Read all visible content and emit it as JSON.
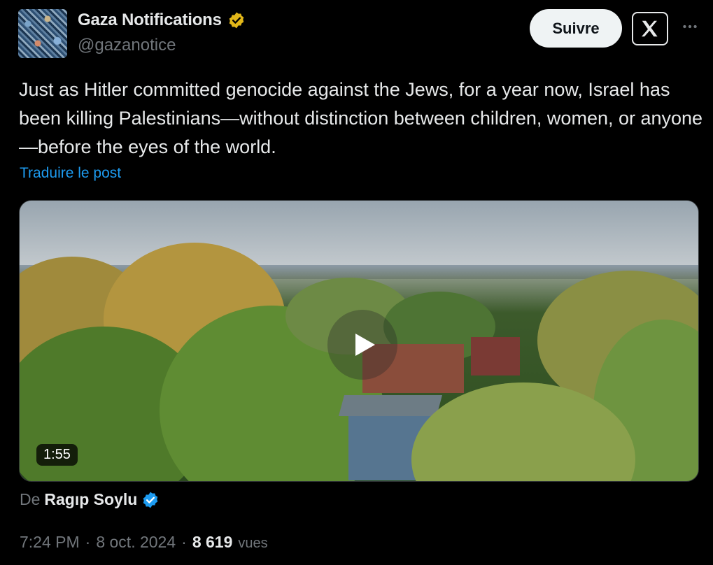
{
  "author": {
    "display_name": "Gaza Notifications",
    "handle": "@gazanotice",
    "verified": "gold-check-icon"
  },
  "actions": {
    "follow_label": "Suivre",
    "brand_icon": "x-logo-icon",
    "more_icon": "more-dots-icon"
  },
  "tweet": {
    "text": "Just as Hitler committed genocide against the Jews, for a year now, Israel has been killing Palestinians—without distinction between children, women, or anyone—before the eyes of the world.",
    "translate_label": "Traduire le post"
  },
  "media": {
    "duration": "1:55",
    "play_icon": "play-icon"
  },
  "attribution": {
    "prefix": "De",
    "name": "Ragıp Soylu",
    "verified": "blue-check-icon"
  },
  "meta": {
    "time": "7:24 PM",
    "separator": "·",
    "date": "8 oct. 2024",
    "views_count": "8 619",
    "views_label": "vues"
  },
  "colors": {
    "background": "#000000",
    "text_primary": "#e7e9ea",
    "text_secondary": "#71767b",
    "link": "#1d9bf0",
    "gold_badge": "#e2b719",
    "blue_badge": "#1d9bf0"
  }
}
